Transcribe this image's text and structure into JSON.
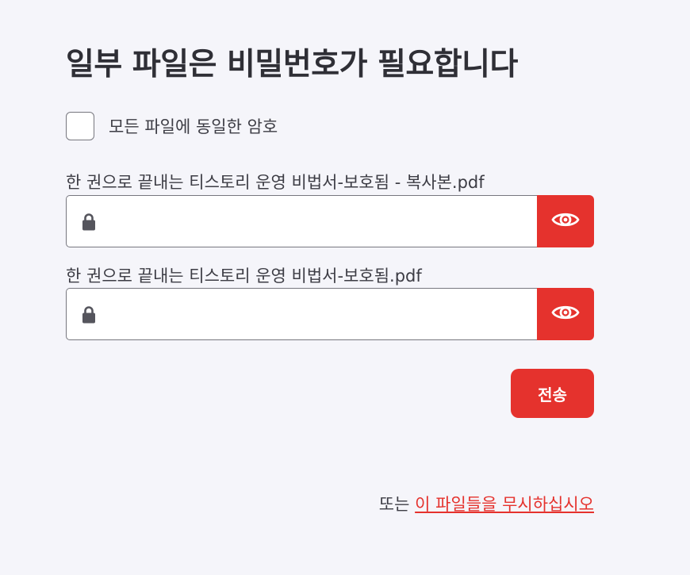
{
  "header": {
    "title": "일부 파일은 비밀번호가 필요합니다"
  },
  "same_password": {
    "label": "모든 파일에 동일한 암호",
    "checked": false
  },
  "files": [
    {
      "name": "한 권으로 끝내는 티스토리 운영 비법서-보호됨 - 복사본.pdf",
      "password_value": "",
      "lock_icon": "lock-icon",
      "toggle_icon": "eye-icon"
    },
    {
      "name": "한 권으로 끝내는 티스토리 운영 비법서-보호됨.pdf",
      "password_value": "",
      "lock_icon": "lock-icon",
      "toggle_icon": "eye-icon"
    }
  ],
  "actions": {
    "submit_label": "전송"
  },
  "footer": {
    "prefix": "또는 ",
    "ignore_link": "이 파일들을 무시하십시오"
  },
  "colors": {
    "accent": "#e5322d",
    "background": "#f5f5fa",
    "text": "#33333b"
  }
}
